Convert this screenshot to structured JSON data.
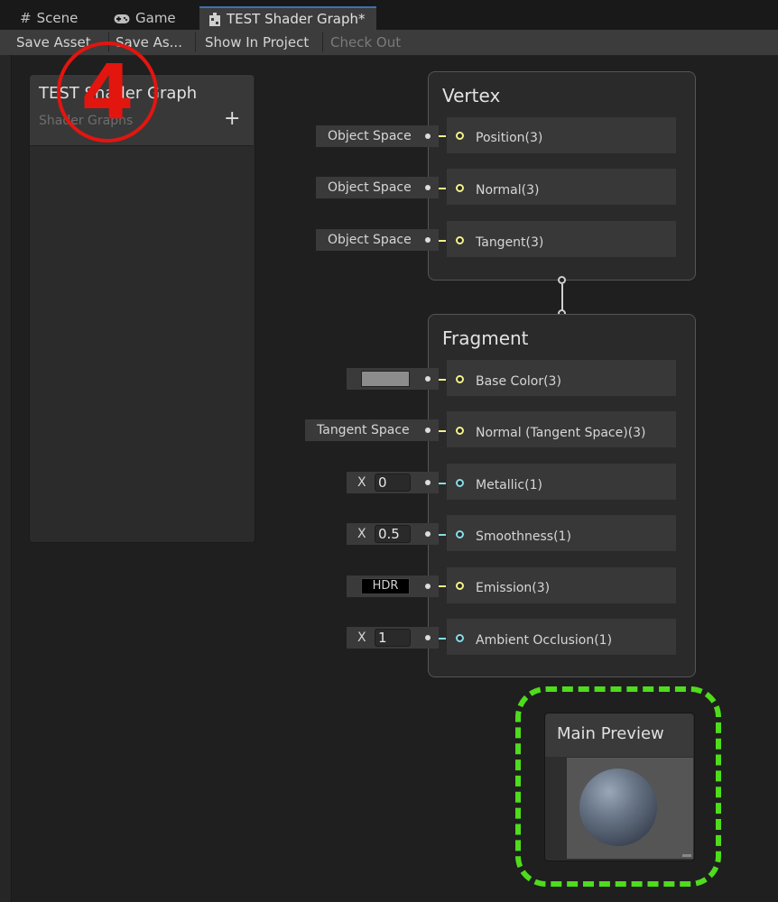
{
  "tabs": [
    {
      "label": "Scene",
      "icon": "grid-hash-icon"
    },
    {
      "label": "Game",
      "icon": "gamepad-icon"
    },
    {
      "label": "TEST Shader Graph*",
      "icon": "shader-graph-icon"
    }
  ],
  "toolbar": {
    "save_asset": "Save Asset",
    "save_as": "Save As...",
    "show_in_project": "Show In Project",
    "check_out": "Check Out"
  },
  "blackboard": {
    "title": "TEST Shader Graph",
    "subtitle": "Shader Graphs",
    "add_label": "+"
  },
  "annotation": {
    "label": "4",
    "color": "#e3150f"
  },
  "vertex": {
    "title": "Vertex",
    "blocks": [
      {
        "label": "Position(3)",
        "field": "Object Space"
      },
      {
        "label": "Normal(3)",
        "field": "Object Space"
      },
      {
        "label": "Tangent(3)",
        "field": "Object Space"
      }
    ]
  },
  "fragment": {
    "title": "Fragment",
    "blocks": [
      {
        "label": "Base Color(3)",
        "field_color": "#8c8c8c"
      },
      {
        "label": "Normal (Tangent Space)(3)",
        "field": "Tangent Space"
      },
      {
        "label": "Metallic(1)",
        "axis": "X",
        "value": "0"
      },
      {
        "label": "Smoothness(1)",
        "axis": "X",
        "value": "0.5"
      },
      {
        "label": "Emission(3)",
        "field": "HDR"
      },
      {
        "label": "Ambient Occlusion(1)",
        "axis": "X",
        "value": "1"
      }
    ]
  },
  "main_preview": {
    "title": "Main Preview",
    "highlight_color": "#4fdc1c"
  },
  "colors": {
    "vector3_port": "#f2f28a",
    "float_port": "#86dbe6",
    "active_tab_accent": "#3a72b0"
  }
}
